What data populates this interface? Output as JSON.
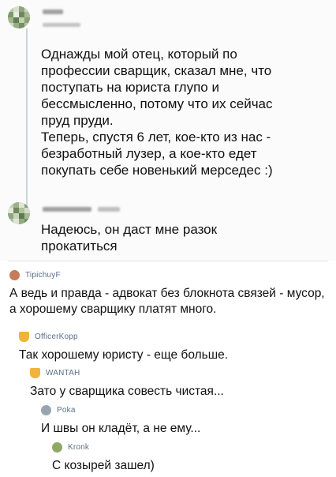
{
  "post": {
    "text_lines": [
      "Однажды мой отец, который по",
      "профессии сварщик, сказал мне, что",
      "поступать на юриста глупо и",
      "бессмысленно, потому что их сейчас",
      "пруд пруди.",
      "Теперь, спустя 6 лет, кое-кто из нас -",
      "безработный лузер, а кое-кто едет",
      "покупать себе новенький мерседес :)"
    ],
    "reply_lines": [
      "Надеюсь, он даст мне разок",
      "прокатиться"
    ]
  },
  "comments": [
    {
      "user": "TipichuyF",
      "text": "А ведь и правда - адвокат без блокнота связей - мусор, а хорошему сварщику платят много.",
      "avatar_color": "#c77b5a"
    },
    {
      "user": "OfficerKopp",
      "text": "Так хорошему юристу - еще больше.",
      "avatar_color": "#f0b43c"
    },
    {
      "user": "WANTAH",
      "text": "Зато у сварщика совесть чистая...",
      "avatar_color": "#f0b43c"
    },
    {
      "user": "Poka",
      "text": "И швы он кладёт, а не ему...",
      "avatar_color": "#9aa4ae"
    },
    {
      "user": "Kronk",
      "text": "С козырей зашел)",
      "avatar_color": "#8fa866"
    }
  ]
}
